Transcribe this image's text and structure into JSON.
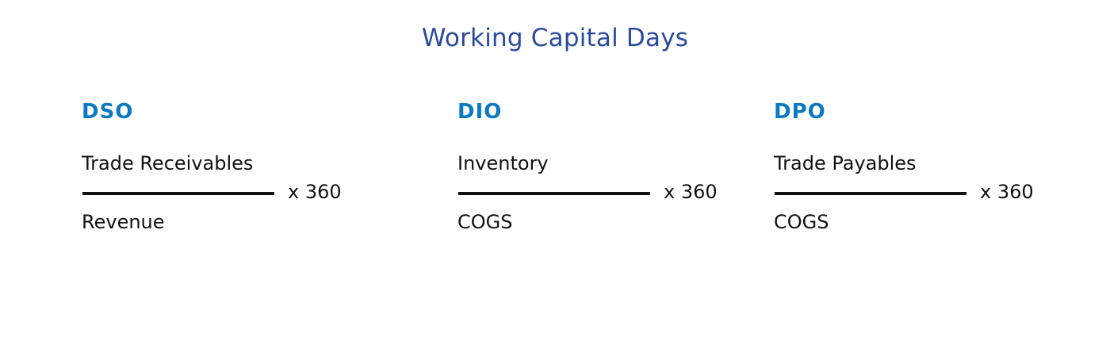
{
  "title": "Working Capital Days",
  "colors": {
    "title": "#2a4a9e",
    "metric": "#0a79c4",
    "text": "#111111"
  },
  "formulas": [
    {
      "name": "DSO",
      "numerator": "Trade Receivables",
      "denominator": "Revenue",
      "multiplier": "x 360"
    },
    {
      "name": "DIO",
      "numerator": "Inventory",
      "denominator": "COGS",
      "multiplier": "x 360"
    },
    {
      "name": "DPO",
      "numerator": "Trade Payables",
      "denominator": "COGS",
      "multiplier": "x 360"
    }
  ]
}
